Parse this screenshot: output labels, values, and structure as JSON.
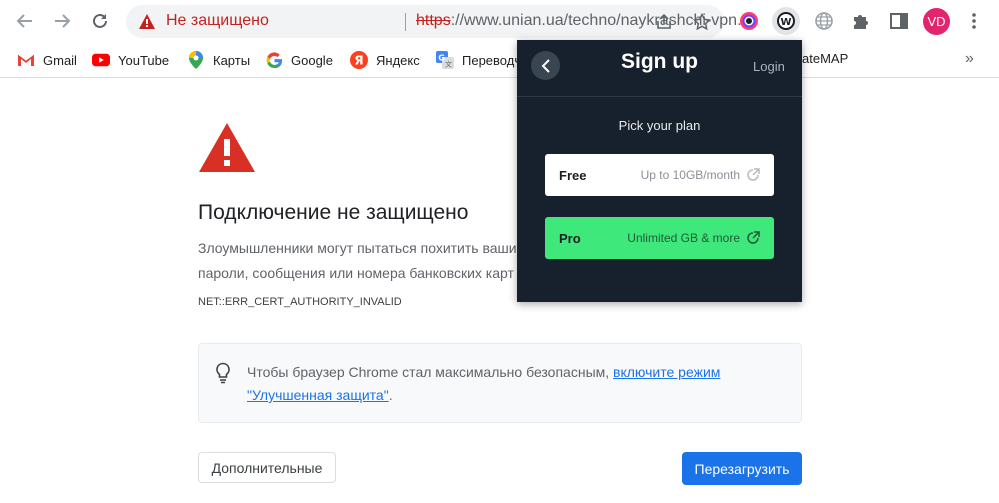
{
  "toolbar": {
    "security_status": "Не защищено",
    "url_scheme": "https",
    "url_rest": "://www.unian.ua/techno/naykrashchi-vpn...",
    "avatar_initials": "VD"
  },
  "bookmarks": {
    "items": [
      {
        "label": "Gmail",
        "icon": "gmail-icon"
      },
      {
        "label": "YouTube",
        "icon": "youtube-icon"
      },
      {
        "label": "Карты",
        "icon": "maps-icon"
      },
      {
        "label": "Google",
        "icon": "google-icon"
      },
      {
        "label": "Яндекс",
        "icon": "yandex-icon"
      },
      {
        "label": "Переводч",
        "icon": "translate-icon"
      }
    ],
    "tail_visible_text": "ateMAP"
  },
  "page": {
    "title": "Подключение не защищено",
    "desc_line1": "Злоумышленники могут пытаться похитить ваши",
    "desc_line2": "пароли, сообщения или номера банковских карт",
    "error_code": "NET::ERR_CERT_AUTHORITY_INVALID",
    "tip_text": "Чтобы браузер Chrome стал максимально безопасным,",
    "tip_link": "включите режим \"Улучшенная защита\"",
    "tip_end": ".",
    "advanced_button": "Дополнительные",
    "reload_button": "Перезагрузить"
  },
  "popup": {
    "title": "Sign up",
    "login": "Login",
    "subtitle": "Pick your plan",
    "plans": [
      {
        "name": "Free",
        "desc": "Up to 10GB/month"
      },
      {
        "name": "Pro",
        "desc": "Unlimited GB & more"
      }
    ]
  },
  "colors": {
    "danger": "#c5221f",
    "primary": "#1a73e8",
    "popup_bg": "#17212d",
    "pro_green": "#3ee87a"
  }
}
